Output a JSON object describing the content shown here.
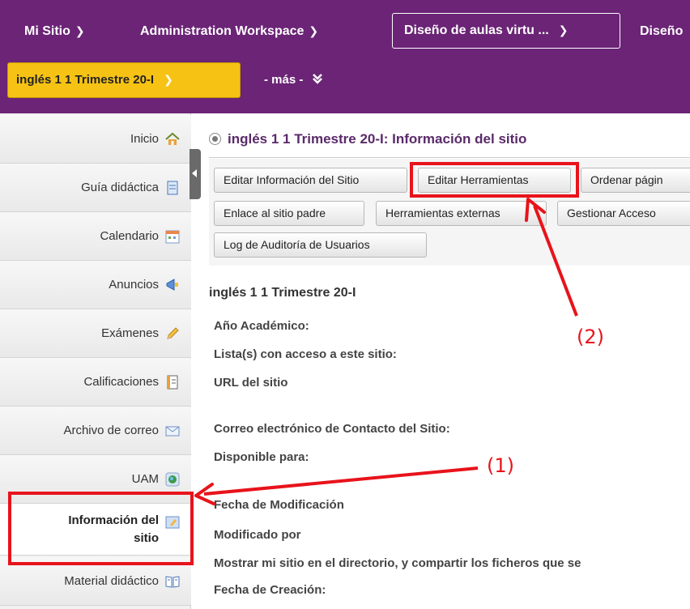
{
  "topnav": {
    "mi_sitio": "Mi Sitio",
    "admin_workspace": "Administration Workspace",
    "site_dropdown": "Diseño de aulas virtu ...",
    "cut_site": "Diseño",
    "current_site": "inglés 1 1 Trimestre 20-I",
    "mas": "- más -"
  },
  "sidebar": {
    "items": [
      {
        "label": "Inicio",
        "icon": "home-icon"
      },
      {
        "label": "Guía didáctica",
        "icon": "document-icon"
      },
      {
        "label": "Calendario",
        "icon": "calendar-icon"
      },
      {
        "label": "Anuncios",
        "icon": "megaphone-icon"
      },
      {
        "label": "Exámenes",
        "icon": "pencil-icon"
      },
      {
        "label": "Calificaciones",
        "icon": "gradebook-icon"
      },
      {
        "label": "Archivo de correo",
        "icon": "envelope-icon"
      },
      {
        "label": "UAM",
        "icon": "globe-icon"
      },
      {
        "label_line1": "Información del",
        "label_line2": "sitio",
        "icon": "site-info-icon",
        "active": true
      },
      {
        "label": "Material didáctico",
        "icon": "book-icon"
      }
    ]
  },
  "main": {
    "title": "inglés 1 1 Trimestre 20-I: Información del sitio",
    "buttons": {
      "editar_info": "Editar Información del Sitio",
      "editar_herramientas": "Editar Herramientas",
      "ordenar": "Ordenar págin",
      "enlace_padre": "Enlace al sitio padre",
      "herramientas_externas": "Herramientas externas",
      "gestionar_acceso": "Gestionar Acceso",
      "log_auditoria": "Log de Auditoría de Usuarios"
    },
    "site_name": "inglés 1 1 Trimestre 20-I",
    "fields": {
      "anio": "Año Académico:",
      "lista": "Lista(s) con acceso a este sitio:",
      "url": "URL del sitio",
      "correo": "Correo electrónico de Contacto del Sitio:",
      "disponible": "Disponible para:",
      "fecha_mod": "Fecha de Modificación",
      "modificado_por": "Modificado por",
      "mostrar": "Mostrar mi sitio en el directorio, y compartir los ficheros que se",
      "fecha_creacion": "Fecha de Creación:"
    }
  },
  "annotations": {
    "label1": "(1)",
    "label2": "(2)",
    "color": "#e8131b"
  },
  "colors": {
    "brand_purple": "#6b2476",
    "current_site_yellow": "#f6c315"
  }
}
